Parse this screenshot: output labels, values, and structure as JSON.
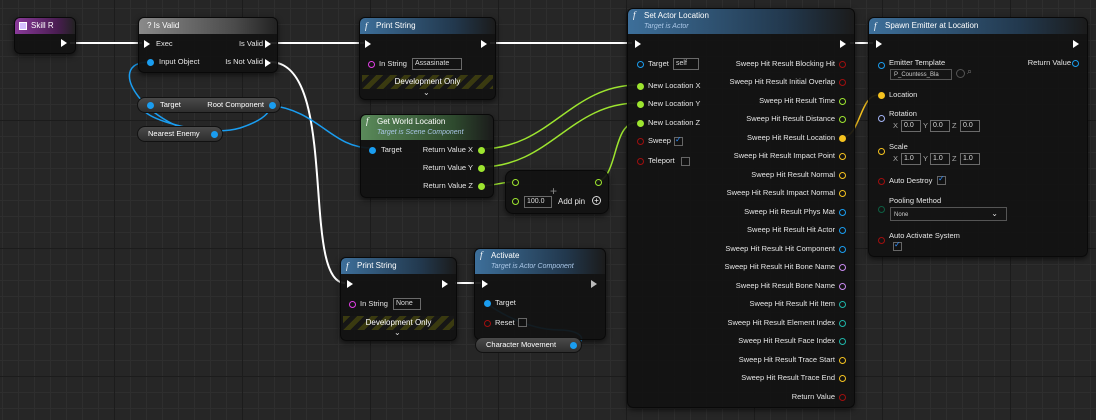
{
  "colors": {
    "exec": "#ffffff",
    "object": "#1a9df0",
    "float": "#9de52f",
    "bool": "#a00f0f",
    "string": "#e23fe6",
    "vector": "#f5c21f",
    "struct": "#2f8fd6",
    "hit_result": "#2f8fd6",
    "rotator": "#a4b4f5",
    "name": "#c98af0",
    "actor": "#1fb5a8",
    "enum": "#0d5e42"
  },
  "nodes": {
    "skill_r": {
      "title": "Skill R"
    },
    "is_valid": {
      "title": "? Is Valid",
      "exec": "Exec",
      "is_valid": "Is Valid",
      "input_object": "Input Object",
      "is_not_valid": "Is Not Valid"
    },
    "print_string_1": {
      "title": "Print String",
      "in_string_label": "In String",
      "in_string_value": "Assasinate",
      "dev_only": "Development Only"
    },
    "get_world_location": {
      "title": "Get World Location",
      "subtitle": "Target is Scene Component",
      "target": "Target",
      "rx": "Return Value X",
      "ry": "Return Value Y",
      "rz": "Return Value Z"
    },
    "add_node": {
      "value": "100.0",
      "add_pin": "Add pin"
    },
    "print_string_2": {
      "title": "Print String",
      "in_string_label": "In String",
      "in_string_value": "None",
      "dev_only": "Development Only"
    },
    "activate": {
      "title": "Activate",
      "subtitle": "Target is Actor Component",
      "target": "Target",
      "reset": "Reset"
    },
    "set_actor_location": {
      "title": "Set Actor Location",
      "subtitle": "Target is Actor",
      "inputs": {
        "target": "Target",
        "target_value": "self",
        "x": "New Location X",
        "y": "New Location Y",
        "z": "New Location Z",
        "sweep": "Sweep",
        "teleport": "Teleport"
      },
      "outputs": [
        "Sweep Hit Result Blocking Hit",
        "Sweep Hit Result Initial Overlap",
        "Sweep Hit Result Time",
        "Sweep Hit Result Distance",
        "Sweep Hit Result Location",
        "Sweep Hit Result Impact Point",
        "Sweep Hit Result Normal",
        "Sweep Hit Result Impact Normal",
        "Sweep Hit Result Phys Mat",
        "Sweep Hit Result Hit Actor",
        "Sweep Hit Result Hit Component",
        "Sweep Hit Result Hit Bone Name",
        "Sweep Hit Result Bone Name",
        "Sweep Hit Result Hit Item",
        "Sweep Hit Result Element Index",
        "Sweep Hit Result Face Index",
        "Sweep Hit Result Trace Start",
        "Sweep Hit Result Trace End",
        "Return Value"
      ]
    },
    "spawn_emitter": {
      "title": "Spawn Emitter at Location",
      "emitter_template": "Emitter Template",
      "emitter_value": "P_Countess_Bla",
      "return_value": "Return Value",
      "location": "Location",
      "rotation": "Rotation",
      "scale": "Scale",
      "axis_x": "X",
      "axis_y": "Y",
      "axis_z": "Z",
      "rot_x": "0.0",
      "rot_y": "0.0",
      "rot_z": "0.0",
      "scale_x": "1.0",
      "scale_y": "1.0",
      "scale_z": "1.0",
      "auto_destroy": "Auto Destroy",
      "pooling_method": "Pooling Method",
      "pooling_value": "None",
      "auto_activate": "Auto Activate System"
    }
  },
  "variables": {
    "root_component": {
      "target": "Target",
      "label": "Root Component"
    },
    "nearest_enemy": {
      "label": "Nearest Enemy"
    },
    "character_movement": {
      "label": "Character Movement"
    }
  }
}
